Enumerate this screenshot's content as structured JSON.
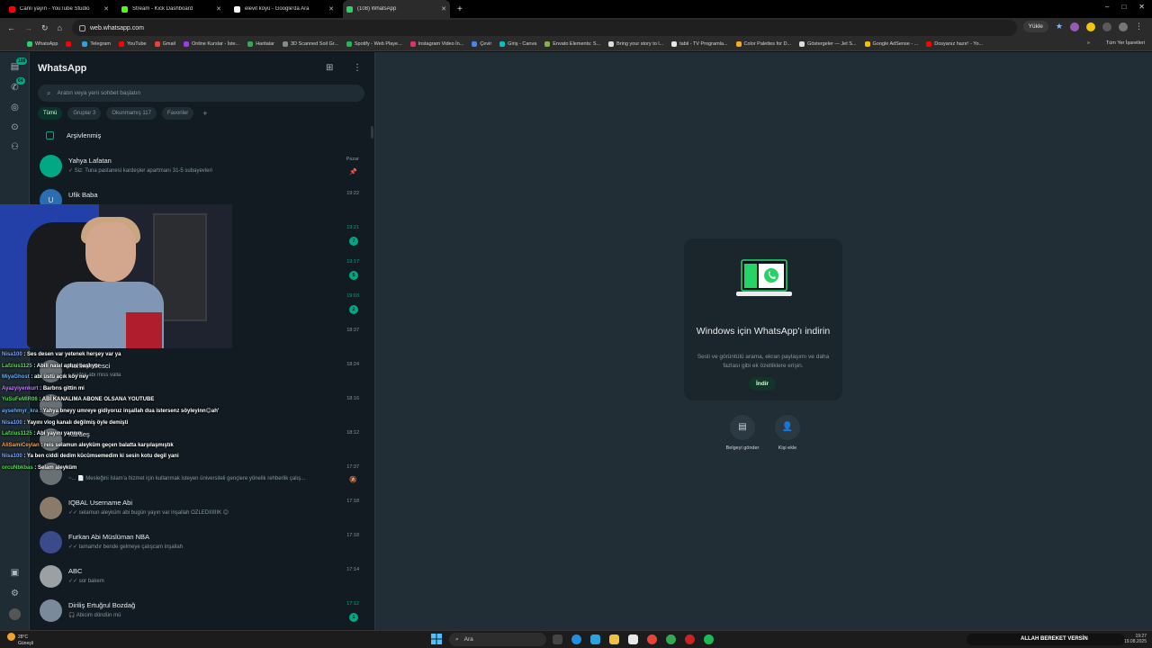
{
  "browser": {
    "tabs": [
      {
        "title": "Canlı yayın - YouTube Studio",
        "color": "#ff0000",
        "active": false
      },
      {
        "title": "Stream - Kick Dashboard",
        "color": "#53fc18",
        "active": false
      },
      {
        "title": "elevit köyü - Google'da Ara",
        "color": "#ffffff",
        "active": false
      },
      {
        "title": "(108) WhatsApp",
        "color": "#25d366",
        "active": true
      }
    ],
    "new_tab": "+",
    "url": "web.whatsapp.com",
    "install_label": "Yükle",
    "bookmarks": [
      {
        "label": "WhatsApp",
        "color": "#25d366"
      },
      {
        "label": "",
        "color": "#ff0000"
      },
      {
        "label": "Telegram",
        "color": "#2aa3e0"
      },
      {
        "label": "YouTube",
        "color": "#ff0000"
      },
      {
        "label": "Gmail",
        "color": "#ea4335"
      },
      {
        "label": "Online Kurslar - İste...",
        "color": "#a435f0"
      },
      {
        "label": "Haritalar",
        "color": "#34a853"
      },
      {
        "label": "3D Scanned Soil Gr...",
        "color": "#888888"
      },
      {
        "label": "Spotify - Web Playe...",
        "color": "#1db954"
      },
      {
        "label": "Instagram Video İn...",
        "color": "#e1306c"
      },
      {
        "label": "Çevir",
        "color": "#4285f4"
      },
      {
        "label": "Giriş - Canva",
        "color": "#00c4cc"
      },
      {
        "label": "Envato Elements: S...",
        "color": "#82b541"
      },
      {
        "label": "Bring your story to l...",
        "color": "#dddddd"
      },
      {
        "label": "tabii - TV Programla...",
        "color": "#e6e6e6"
      },
      {
        "label": "Color Palettes for D...",
        "color": "#f9a825"
      },
      {
        "label": "Göstergeler — Jet S...",
        "color": "#dddddd"
      },
      {
        "label": "Google AdSense - ...",
        "color": "#fbbc04"
      },
      {
        "label": "Dosyanız hazır! - Yo...",
        "color": "#ff0000"
      }
    ],
    "bookmarks_overflow": "»",
    "all_bookmarks": "Tüm Yer İşaretleri"
  },
  "whatsapp": {
    "title": "WhatsApp",
    "search_placeholder": "Aratın veya yeni sohbet başlatın",
    "filters": [
      {
        "label": "Tümü",
        "active": true
      },
      {
        "label": "Gruplar 3",
        "active": false
      },
      {
        "label": "Okunmamış 117",
        "active": false
      },
      {
        "label": "Favoriler",
        "active": false
      }
    ],
    "filter_add": "+",
    "archived_label": "Arşivlenmiş",
    "rail_badges": {
      "chats": "108",
      "calls": "64"
    },
    "chats": [
      {
        "name": "Yahya Lafatan",
        "preview": "✓ Siz: Tuna pastanesi kardeşler apartmanı 31-5 subayevleri",
        "time": "Pazar",
        "time_green": false,
        "unread": "",
        "indicator": "📌",
        "avatar": "",
        "avatar_color": "#00a884"
      },
      {
        "name": "Ufik Baba",
        "preview": "",
        "time": "19:22",
        "time_green": false,
        "unread": "",
        "indicator": "",
        "avatar": "U",
        "avatar_color": "#2a6db0"
      },
      {
        "name": "",
        "preview": "",
        "time": "19:21",
        "time_green": true,
        "unread": "7",
        "indicator": "",
        "avatar": "",
        "avatar_color": "#6a7175"
      },
      {
        "name": "",
        "preview": "",
        "time": "19:17",
        "time_green": true,
        "unread": "5",
        "indicator": "🔕",
        "avatar": "",
        "avatar_color": "#6a7175"
      },
      {
        "name": "",
        "preview": "",
        "time": "19:03",
        "time_green": true,
        "unread": "2",
        "indicator": "",
        "avatar": "",
        "avatar_color": "#6a7175"
      },
      {
        "name": "",
        "preview": "",
        "time": "18:37",
        "time_green": false,
        "unread": "",
        "indicator": "",
        "avatar": "",
        "avatar_color": "#6a7175"
      },
      {
        "name": "Rahimh Sesci",
        "preview": "...sağlık abi miss valla",
        "time": "18:24",
        "time_green": false,
        "unread": "",
        "indicator": "",
        "avatar": "",
        "avatar_color": "#6a7175"
      },
      {
        "name": "",
        "preview": "",
        "time": "18:16",
        "time_green": false,
        "unread": "",
        "indicator": "",
        "avatar": "",
        "avatar_color": "#6a7175"
      },
      {
        "name": "Kardeş",
        "preview": "",
        "time": "18:12",
        "time_green": false,
        "unread": "",
        "indicator": "",
        "avatar": "",
        "avatar_color": "#6a7175"
      },
      {
        "name": "",
        "preview": "~... 📄 Mesleğini İslam'a hizmet için kullanmak isteyen üniversiteli gençlere yönelik rehberlik çalış...",
        "time": "17:37",
        "time_green": false,
        "unread": "",
        "indicator": "🔕",
        "avatar": "",
        "avatar_color": "#6a7175"
      },
      {
        "name": "IQBAL Username Abi",
        "preview": "✓✓ selamun aleyküm abi bugün yayın var inşallah ÖZLEDİİİİİİK 😊",
        "time": "17:18",
        "time_green": false,
        "unread": "",
        "indicator": "",
        "avatar": "",
        "avatar_color": "#8a7a6a"
      },
      {
        "name": "Furkan Abi Müslüman NBA",
        "preview": "✓✓ tamamdır bende gelmeye çalışcam inşallah",
        "time": "17:18",
        "time_green": false,
        "unread": "",
        "indicator": "",
        "avatar": "",
        "avatar_color": "#3a4a8a"
      },
      {
        "name": "ABC",
        "preview": "✓✓ sor bakem",
        "time": "17:14",
        "time_green": false,
        "unread": "",
        "indicator": "",
        "avatar": "",
        "avatar_color": "#9aa0a4"
      },
      {
        "name": "Diriliş Ertuğrul Bozdağ",
        "preview": "🎧 Abicim döndün mü",
        "time": "17:12",
        "time_green": true,
        "unread": "1",
        "indicator": "",
        "avatar": "",
        "avatar_color": "#7a8a9a"
      }
    ],
    "promo": {
      "title": "Windows için WhatsApp'ı indirin",
      "subtitle": "Sesli ve görüntülü arama, ekran paylaşımı ve daha fazlası gibi ek özelliklere erişin.",
      "button": "İndir"
    },
    "actions": [
      {
        "label": "Belgeyi gönder",
        "icon": "document-icon"
      },
      {
        "label": "Kişi ekle",
        "icon": "add-contact-icon"
      }
    ]
  },
  "stream_chat": [
    {
      "user": "Nisa100",
      "color": "#7aa2ff",
      "msg": "Ses desen var yetenek herşey var ya"
    },
    {
      "user": "Lafzius1125",
      "color": "#5fd35f",
      "msg": "Abili nasıl aplus başlıyor"
    },
    {
      "user": "MiyaGhost",
      "color": "#5fb0ff",
      "msg": "abi üstü açık köy ney"
    },
    {
      "user": "Ayazyiyenkurt",
      "color": "#c77dff",
      "msg": "Barbrıs gittin mi"
    },
    {
      "user": "YuSuFeMİR06",
      "color": "#5fd35f",
      "msg": "ABİ KANALIMA ABONE OLSANA YOUTUBE"
    },
    {
      "user": "aysehmyr_kra",
      "color": "#5fb0ff",
      "msg": "Yahya bneyy umreye gidiyoruz inşallah dua istersenz söyleyinn😊ah'"
    },
    {
      "user": "Nisa100",
      "color": "#7aa2ff",
      "msg": "Yayını vlog kanalı değilmiş öyle demişti"
    },
    {
      "user": "Lafzius1125",
      "color": "#5fd35f",
      "msg": "Abi yayını yarının"
    },
    {
      "user": "AliSamiCeylan",
      "color": "#ff9f43",
      "msg": "reis selamun aleyküm geçen balatta karşılaşmıştık"
    },
    {
      "user": "Nisa100",
      "color": "#7aa2ff",
      "msg": "Ya ben ciddi dedim kücümsemedim ki sesin kotu degil yani"
    },
    {
      "user": "orcuNbkbas",
      "color": "#5fd35f",
      "msg": "Selam aleyküm"
    }
  ],
  "taskbar": {
    "weather_temp": "28°C",
    "weather_desc": "Güneşli",
    "search_placeholder": "Ara",
    "ticker": "ALLAH BEREKET VERSİN",
    "clock_time": "19:27",
    "clock_date": "19.08.2025"
  }
}
